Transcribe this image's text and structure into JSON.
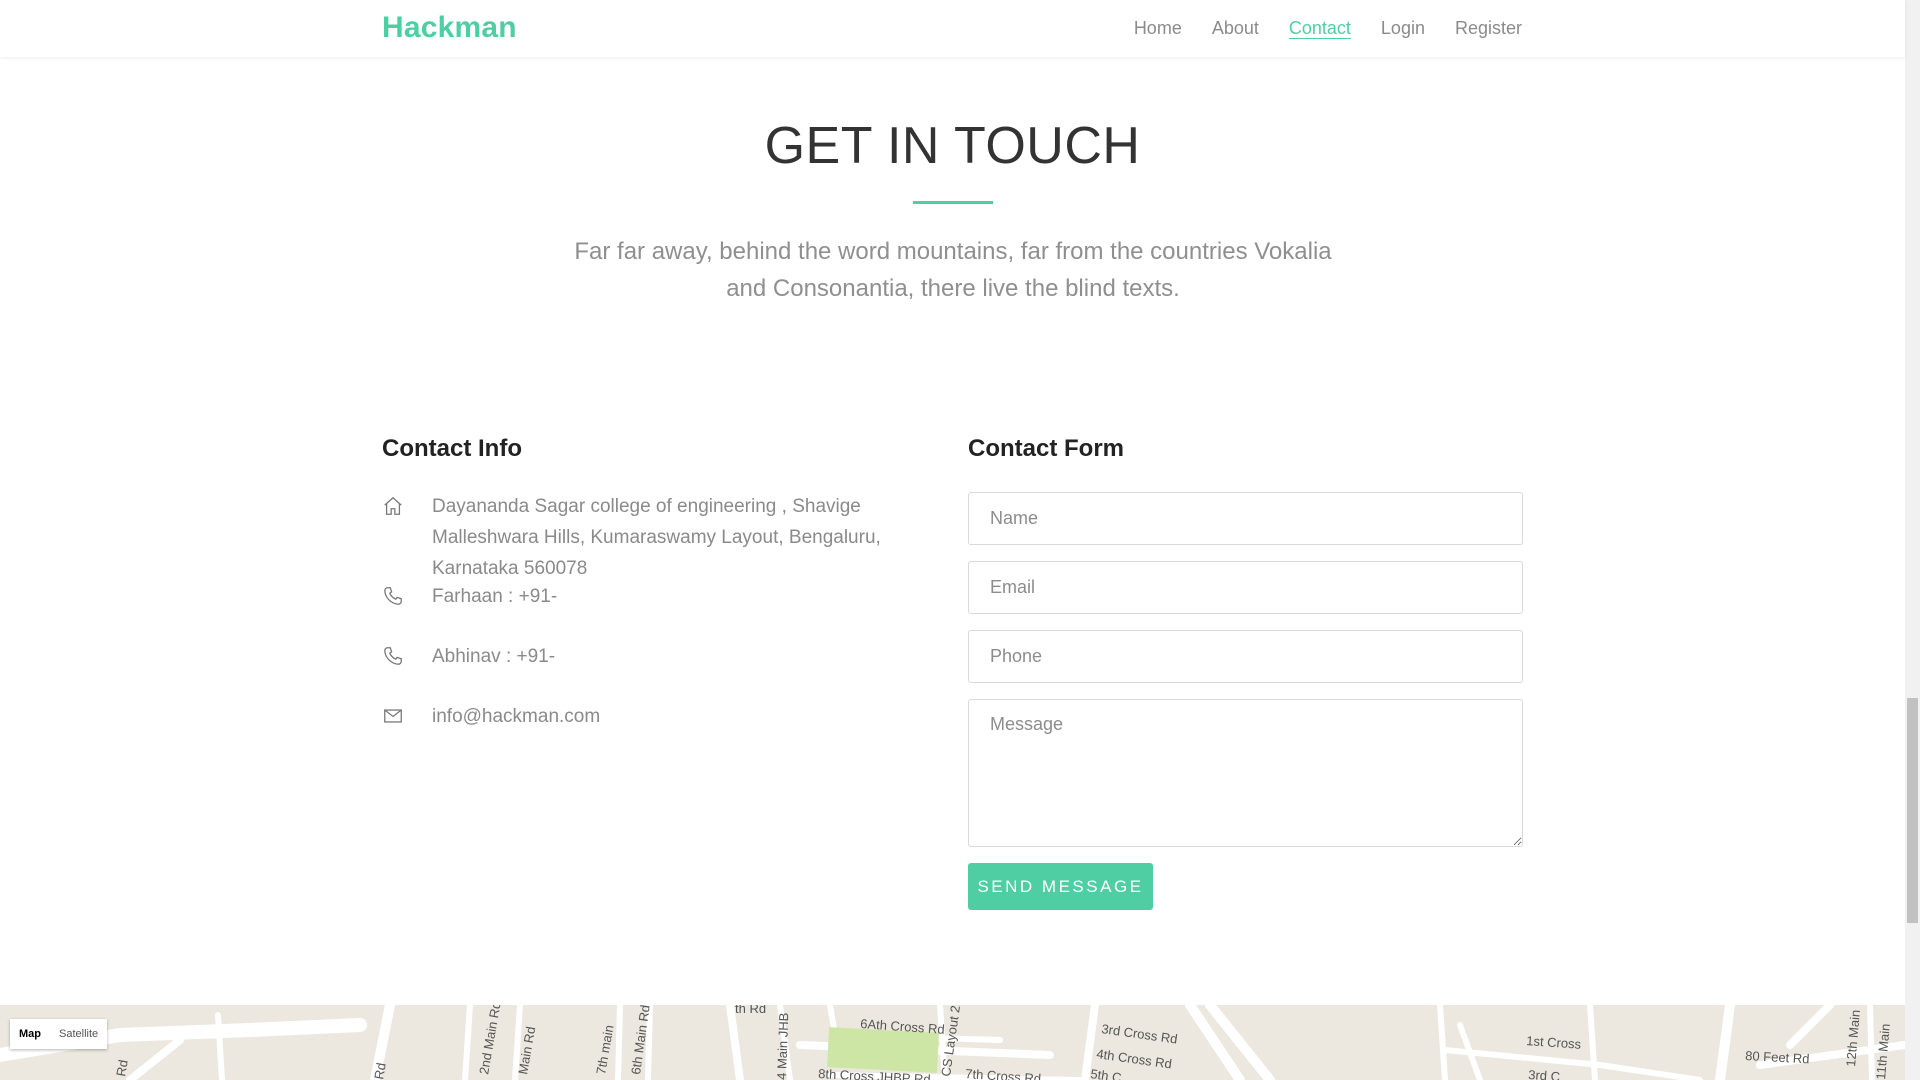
{
  "header": {
    "brand": "Hackman",
    "nav": [
      {
        "label": "Home"
      },
      {
        "label": "About"
      },
      {
        "label": "Contact",
        "active": true
      },
      {
        "label": "Login"
      },
      {
        "label": "Register"
      }
    ]
  },
  "hero": {
    "title": "GET IN TOUCH",
    "lead": "Far far away, behind the word mountains, far from the countries Vokalia and Consonantia, there live the blind texts."
  },
  "contact_info": {
    "title": "Contact Info",
    "address": "Dayananda Sagar college of engineering , Shavige Malleshwara Hills, Kumaraswamy Layout, Bengaluru, Karnataka 560078",
    "phone1": "Farhaan : +91-",
    "phone2": "Abhinav : +91-",
    "email": "info@hackman.com",
    "icons": [
      "home-icon",
      "phone-icon",
      "phone-icon",
      "mail-icon"
    ]
  },
  "contact_form": {
    "title": "Contact Form",
    "name_placeholder": "Name",
    "email_placeholder": "Email",
    "phone_placeholder": "Phone",
    "message_placeholder": "Message",
    "submit_label": "SEND MESSAGE"
  },
  "map": {
    "toggle_map": "Map",
    "toggle_satellite": "Satellite",
    "street_labels": [
      "Rd",
      "2nd Main Rd",
      "Main Rd",
      "7th main",
      "6th Main Rd",
      "4 Main JHB",
      "6Ath Cross Rd",
      "8th Cross JHBP Rd",
      "CS Layout 2r",
      "7th Cross Rd",
      "3rd Cross Rd",
      "4th Cross Rd",
      "5th C",
      "1st Cross",
      "3rd C",
      "80 Feet Rd",
      "12th Main",
      "11th Main",
      "Rd",
      "th Rd"
    ]
  },
  "colors": {
    "accent": "#4fcea4",
    "map_bg": "#ece8df",
    "park": "#cde6a6"
  }
}
